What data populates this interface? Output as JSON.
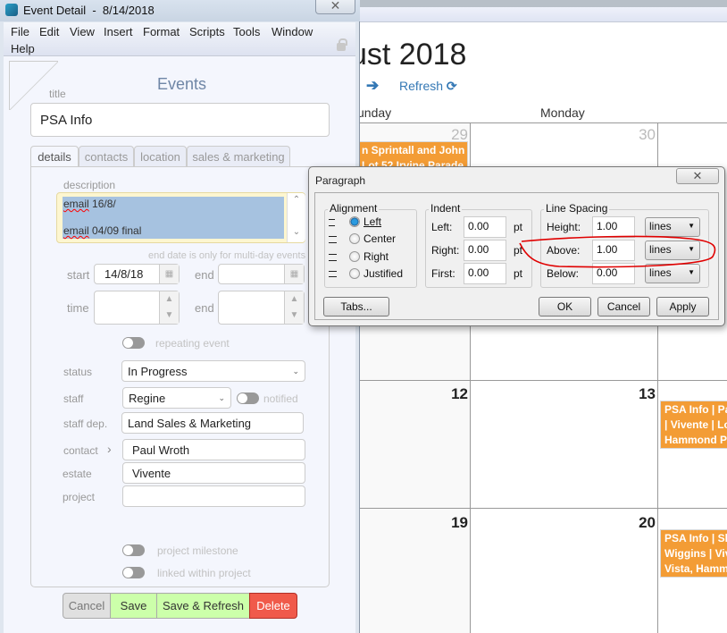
{
  "calendar": {
    "month_title": "ust 2018",
    "refresh_label": "Refresh",
    "day_headers": [
      "unday",
      "Monday"
    ],
    "days": {
      "d29": "29",
      "d30": "30",
      "d12": "12",
      "d13": "13",
      "d19": "19",
      "d20": "20"
    },
    "events": [
      {
        "lines": [
          "n Sprintall and John",
          "Lot 52 Irvine Parade"
        ]
      },
      {
        "lines": [
          "PSA Info | Pa",
          "| Vivente | Lot",
          "Hammond Pa"
        ]
      },
      {
        "lines": [
          "PSA Info | Sh",
          "Wiggins | Vive",
          "Vista, Hammo"
        ]
      }
    ],
    "event_color": "#f39c35"
  },
  "window": {
    "title": "Event Detail  -  8/14/2018",
    "menu": [
      "File",
      "Edit",
      "View",
      "Insert",
      "Format",
      "Scripts",
      "Tools",
      "Window",
      "Help"
    ],
    "heading": "Events",
    "title_label": "title",
    "title_value": "PSA Info",
    "tabs": [
      "details",
      "contacts",
      "location",
      "sales & marketing"
    ],
    "description_label": "description",
    "description_lines": [
      {
        "word": "email",
        "rest": " 16/8/"
      },
      {
        "word": "email",
        "rest": " 04/09 final"
      }
    ],
    "hint": "end date is only for multi-day events",
    "start_label": "start",
    "start_value": "14/8/18",
    "end_label": "end",
    "time_label": "time",
    "repeating_label": "repeating event",
    "status_label": "status",
    "status_value": "In Progress",
    "staff_label": "staff",
    "staff_value": "Regine",
    "notified_label": "notified",
    "staff_dep_label": "staff dep.",
    "staff_dep_value": "Land Sales & Marketing",
    "contact_label": "contact",
    "contact_value": "Paul Wroth",
    "estate_label": "estate",
    "estate_value": "Vivente",
    "project_label": "project",
    "project_value": "",
    "milestone_label": "project milestone",
    "linked_label": "linked within project",
    "buttons": {
      "cancel": "Cancel",
      "save": "Save",
      "save_refresh": "Save & Refresh",
      "delete": "Delete"
    },
    "colors": {
      "save": "#ccffaa",
      "delete": "#f05a4a"
    }
  },
  "dialog": {
    "title": "Paragraph",
    "alignment": {
      "label": "Alignment",
      "options": [
        "Left",
        "Center",
        "Right",
        "Justified"
      ],
      "selected": "Left"
    },
    "indent": {
      "label": "Indent",
      "left_label": "Left:",
      "left": "0.00",
      "right_label": "Right:",
      "right": "0.00",
      "first_label": "First:",
      "first": "0.00",
      "unit": "pt"
    },
    "spacing": {
      "label": "Line Spacing",
      "height_label": "Height:",
      "height": "1.00",
      "above_label": "Above:",
      "above": "1.00",
      "below_label": "Below:",
      "below": "0.00",
      "unit": "lines"
    },
    "buttons": {
      "tabs": "Tabs...",
      "ok": "OK",
      "cancel": "Cancel",
      "apply": "Apply"
    },
    "annotation_color": "#e00000"
  }
}
